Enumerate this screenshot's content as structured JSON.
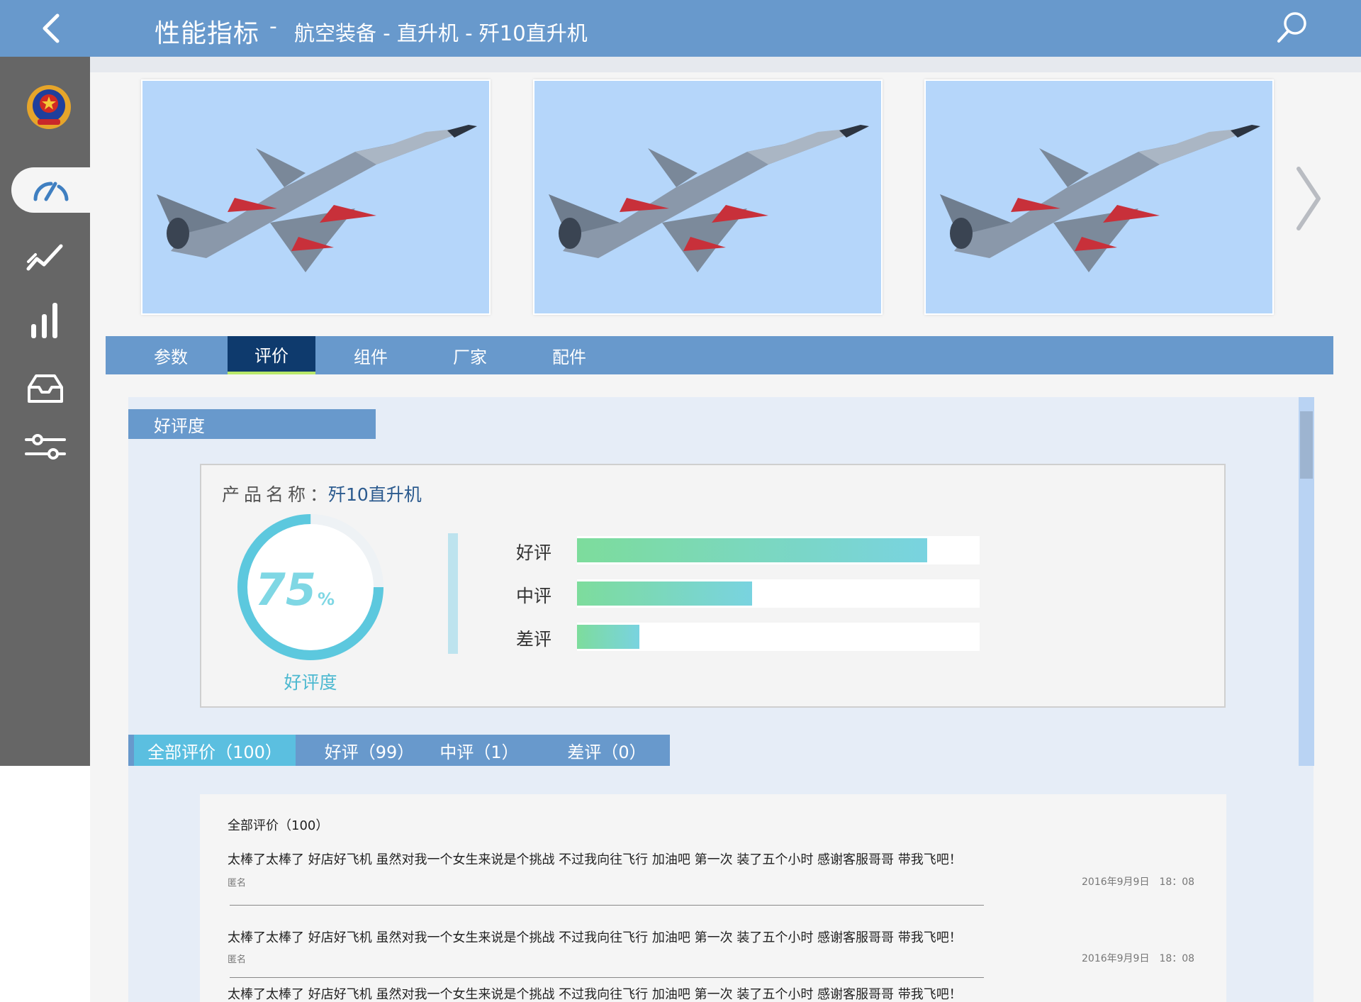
{
  "header": {
    "title": "性能指标",
    "separator": "-",
    "breadcrumb": "航空装备 - 直升机 - 歼10直升机"
  },
  "tabs": [
    "参数",
    "评价",
    "组件",
    "厂家",
    "配件"
  ],
  "active_tab": "评价",
  "section": {
    "label": "好评度"
  },
  "rating": {
    "product_label": "产品名称：",
    "product_name": "歼10直升机",
    "percent_value": "75",
    "percent_sign": "%",
    "percent_fraction": 0.75,
    "caption": "好评度",
    "bars": [
      {
        "label": "好评",
        "fraction": 0.87
      },
      {
        "label": "中评",
        "fraction": 0.435
      },
      {
        "label": "差评",
        "fraction": 0.155
      }
    ]
  },
  "review_tabs": [
    "全部评价（100）",
    "好评（99）",
    "中评（1）",
    "差评（0）"
  ],
  "reviews": {
    "heading": "全部评价（100）",
    "items": [
      {
        "text": "太棒了太棒了 好店好飞机 虽然对我一个女生来说是个挑战 不过我向往飞行 加油吧 第一次 装了五个小时 感谢客服哥哥 带我飞吧！",
        "user": "匿名",
        "time": "2016年9月9日　18：08"
      },
      {
        "text": "太棒了太棒了 好店好飞机 虽然对我一个女生来说是个挑战 不过我向往飞行 加油吧 第一次 装了五个小时 感谢客服哥哥 带我飞吧！",
        "user": "匿名",
        "time": "2016年9月9日　18：08"
      },
      {
        "text": "太棒了太棒了 好店好飞机 虽然对我一个女生来说是个挑战 不过我向往飞行 加油吧 第一次 装了五个小时 感谢客服哥哥 带我飞吧！"
      }
    ]
  },
  "colors": {
    "header": "#6899cc",
    "sidebar": "#666666",
    "active_tab": "#0e3a6d",
    "ring": "#5cc8de",
    "bar_start": "#7ddc9c",
    "bar_end": "#79d3e0"
  },
  "icons": [
    "back-arrow-icon",
    "search-icon",
    "emblem-icon",
    "gauge-icon",
    "trend-icon",
    "bar-chart-icon",
    "inbox-icon",
    "sliders-icon",
    "chevron-right-icon"
  ]
}
